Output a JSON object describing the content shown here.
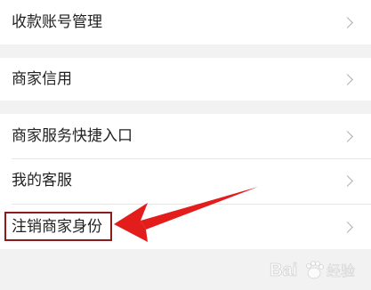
{
  "menu": {
    "items": [
      {
        "label": "收款账号管理"
      },
      {
        "label": "商家信用"
      },
      {
        "label": "商家服务快捷入口"
      },
      {
        "label": "我的客服"
      },
      {
        "label": "注销商家身份"
      }
    ]
  },
  "annotation": {
    "arrow_color": "#e31c1c",
    "box_color": "#8b1c1c"
  },
  "watermark": {
    "text": "Bai",
    "icon": "baidu-paw-icon",
    "suffix": "经验"
  }
}
